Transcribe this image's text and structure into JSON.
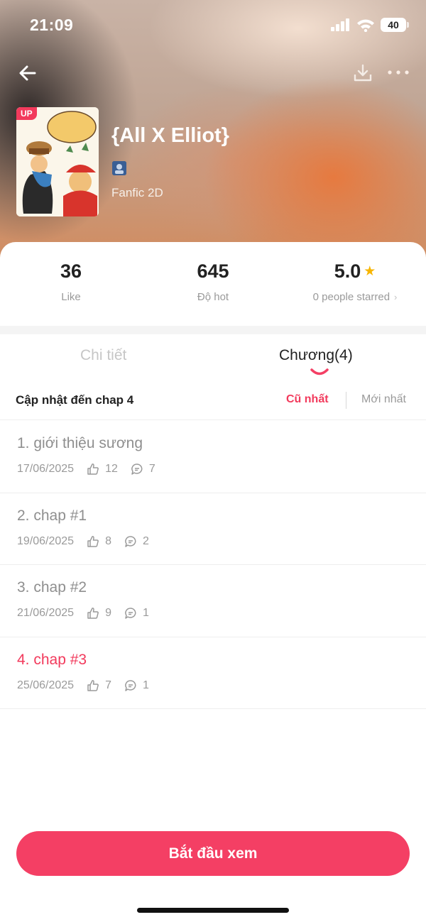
{
  "status_bar": {
    "time": "21:09",
    "battery": "40"
  },
  "header": {
    "back_icon": "back-arrow-icon",
    "download_icon": "download-icon",
    "more_icon": "more-dots-icon"
  },
  "book": {
    "badge": "UP",
    "title": "{All X Elliot}",
    "genre": "Fanfic 2D"
  },
  "stats": {
    "likes": {
      "value": "36",
      "label": "Like"
    },
    "hot": {
      "value": "645",
      "label": "Độ hot"
    },
    "rating": {
      "value": "5.0",
      "label": "0 people starred"
    }
  },
  "tabs": [
    {
      "label": "Chi tiết",
      "active": false
    },
    {
      "label": "Chương(4)",
      "active": true
    }
  ],
  "sort": {
    "update_text": "Cập nhật đến chap 4",
    "oldest": "Cũ nhất",
    "newest": "Mới nhất"
  },
  "chapters": [
    {
      "title": "1. giới thiệu sương",
      "date": "17/06/2025",
      "likes": "12",
      "comments": "7",
      "active": false
    },
    {
      "title": "2. chap #1",
      "date": "19/06/2025",
      "likes": "8",
      "comments": "2",
      "active": false
    },
    {
      "title": "3. chap #2",
      "date": "21/06/2025",
      "likes": "9",
      "comments": "1",
      "active": false
    },
    {
      "title": "4. chap #3",
      "date": "25/06/2025",
      "likes": "7",
      "comments": "1",
      "active": true
    }
  ],
  "start_button": "Bắt đầu xem",
  "colors": {
    "accent": "#f43f64",
    "star": "#f7b500"
  }
}
